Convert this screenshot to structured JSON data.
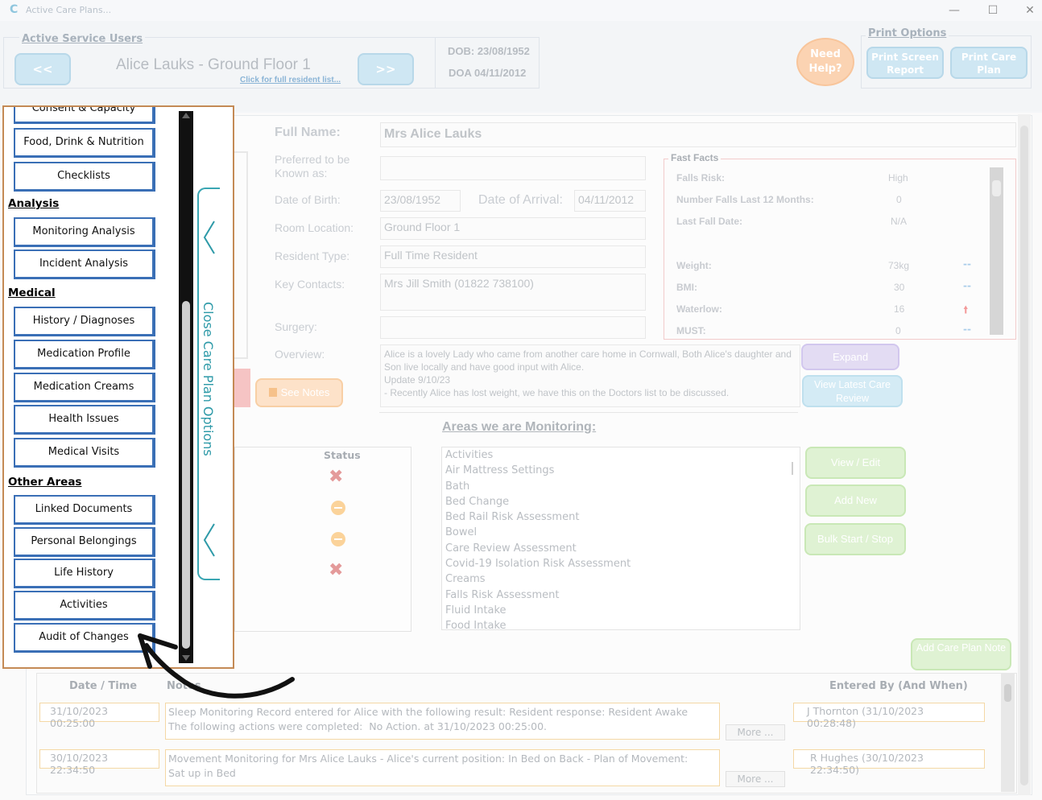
{
  "window": {
    "title": "Active Care Plans..."
  },
  "header": {
    "active_users_legend": "Active Service Users",
    "prev_label": "<<",
    "next_label": ">>",
    "resident_name": "Alice Lauks - Ground Floor 1",
    "resident_list_link": "Click for full resident list...",
    "dob": "DOB: 23/08/1952",
    "doa": "DOA 04/11/2012",
    "need_help": "Need Help?",
    "print_legend": "Print Options",
    "print_screen": "Print Screen Report",
    "print_care_plan": "Print Care Plan"
  },
  "details": {
    "full_name_label": "Full Name:",
    "full_name": "Mrs Alice Lauks",
    "preferred_label": "Preferred to be Known as:",
    "preferred": "",
    "dob_label": "Date of Birth:",
    "dob": "23/08/1952",
    "arrival_label": "Date of Arrival:",
    "arrival": "04/11/2012",
    "room_label": "Room Location:",
    "room": "Ground Floor 1",
    "type_label": "Resident Type:",
    "type": "Full Time Resident",
    "contacts_label": "Key Contacts:",
    "contacts": "Mrs Jill Smith (01822 738100)",
    "surgery_label": "Surgery:",
    "surgery": "",
    "overview_label": "Overview:",
    "overview": "Alice is a lovely Lady who came from another care home in Cornwall, Both Alice's daughter and Son live locally and have good input with Alice.\nUpdate 9/10/23\n- Recently Alice has lost weight, we have this on the Doctors list to be discussed.",
    "see_notes": "See Notes",
    "expand": "Expand",
    "view_latest": "View Latest Care Review"
  },
  "fast_facts": {
    "legend": "Fast Facts",
    "rows": [
      {
        "label": "Falls Risk:",
        "value": "High",
        "trend": ""
      },
      {
        "label": "Number Falls Last 12 Months:",
        "value": "0",
        "trend": ""
      },
      {
        "label": "Last Fall Date:",
        "value": "N/A",
        "trend": ""
      },
      {
        "label": "Weight:",
        "value": "73kg",
        "trend": "--"
      },
      {
        "label": "BMI:",
        "value": "30",
        "trend": "--"
      },
      {
        "label": "Waterlow:",
        "value": "16",
        "trend": "up"
      },
      {
        "label": "MUST:",
        "value": "0",
        "trend": "--"
      }
    ]
  },
  "monitoring": {
    "title": "Areas we are Monitoring:",
    "status_header": "Status",
    "statuses": [
      "cross",
      "dash",
      "dash",
      "cross"
    ],
    "items": [
      "Activities",
      "Air Mattress Settings",
      "Bath",
      "Bed Change",
      "Bed Rail Risk Assessment",
      "Bowel",
      "Care Review Assessment",
      "Covid-19 Isolation Risk Assessment",
      "Creams",
      "Falls Risk Assessment",
      "Fluid Intake",
      "Food Intake"
    ],
    "view_edit": "View / Edit",
    "add_new": "Add New",
    "bulk": "Bulk Start / Stop",
    "add_note": "Add Care Plan Note"
  },
  "notes": {
    "col_date": "Date / Time",
    "col_notes": "Notes",
    "col_entered": "Entered By (And When)",
    "more": "More ...",
    "rows": [
      {
        "date": "31/10/2023 00:25:00",
        "text": "Sleep Monitoring Record entered for Alice with the following result: Resident response: Resident Awake\nThe following actions were completed:  No Action. at 31/10/2023 00:25:00.",
        "by": "J Thornton (31/10/2023 00:28:48)"
      },
      {
        "date": "30/10/2023 22:34:50",
        "text": "Movement Monitoring for Mrs Alice Lauks - Alice's current position: In Bed on Back - Plan of Movement:\nSat up in Bed",
        "by": "R Hughes (30/10/2023 22:34:50)"
      }
    ]
  },
  "sidebar": {
    "close_label": "Close Care Plan Options",
    "top_partial": "Consent & Capacity",
    "sections": [
      {
        "heading": "",
        "items": [
          "Food, Drink & Nutrition",
          "Checklists"
        ]
      },
      {
        "heading": "Analysis",
        "items": [
          "Monitoring Analysis",
          "Incident Analysis"
        ]
      },
      {
        "heading": "Medical",
        "items": [
          "History / Diagnoses",
          "Medication Profile",
          "Medication Creams",
          "Health Issues",
          "Medical Visits"
        ]
      },
      {
        "heading": "Other Areas",
        "items": [
          "Linked Documents",
          "Personal Belongings",
          "Life History",
          "Activities",
          "Audit of Changes"
        ]
      }
    ]
  },
  "colors": {
    "accent": "#3a6fb6",
    "sidebar_border": "#c48a55",
    "help": "#f8c59b"
  }
}
